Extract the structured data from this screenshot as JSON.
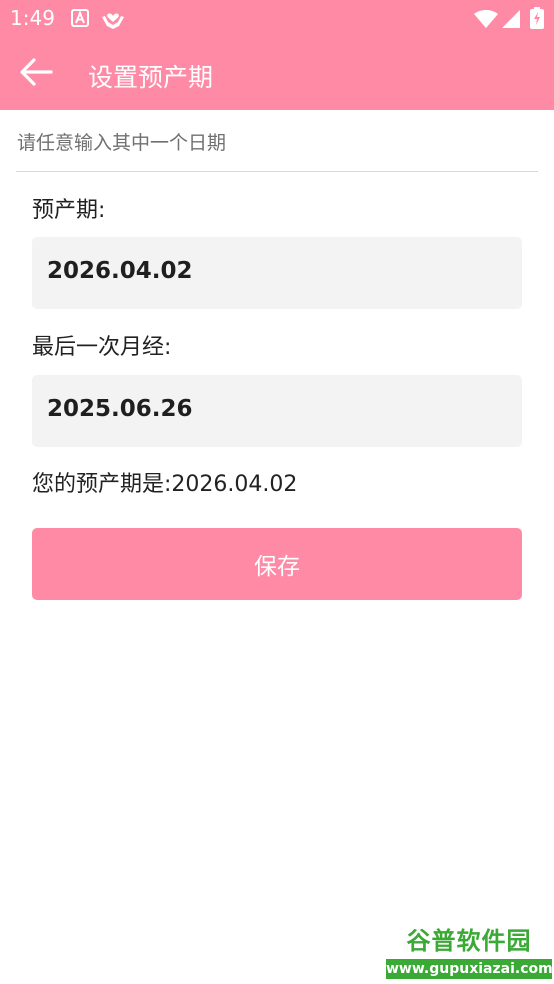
{
  "status_bar": {
    "time": "1:49",
    "left_icons": [
      "font-a-icon",
      "hands-heart-icon"
    ],
    "right_icons": [
      "wifi-icon",
      "signal-icon",
      "battery-icon"
    ]
  },
  "toolbar": {
    "back_icon": "arrow-left-icon",
    "title": "设置预产期"
  },
  "hint": "请任意输入其中一个日期",
  "due_date": {
    "label": "预产期:",
    "value": "2026.04.02"
  },
  "last_period": {
    "label": "最后一次月经:",
    "value": "2025.06.26"
  },
  "result": {
    "label": "您的预产期是:",
    "value": "2026.04.02"
  },
  "save_label": "保存",
  "watermark": {
    "title": "谷普软件园",
    "url": "www.gupuxiazai.com"
  },
  "colors": {
    "accent": "#ff8aa5",
    "field_bg": "#f3f3f3",
    "hint_text": "#707070",
    "watermark_green": "#3aa935"
  }
}
